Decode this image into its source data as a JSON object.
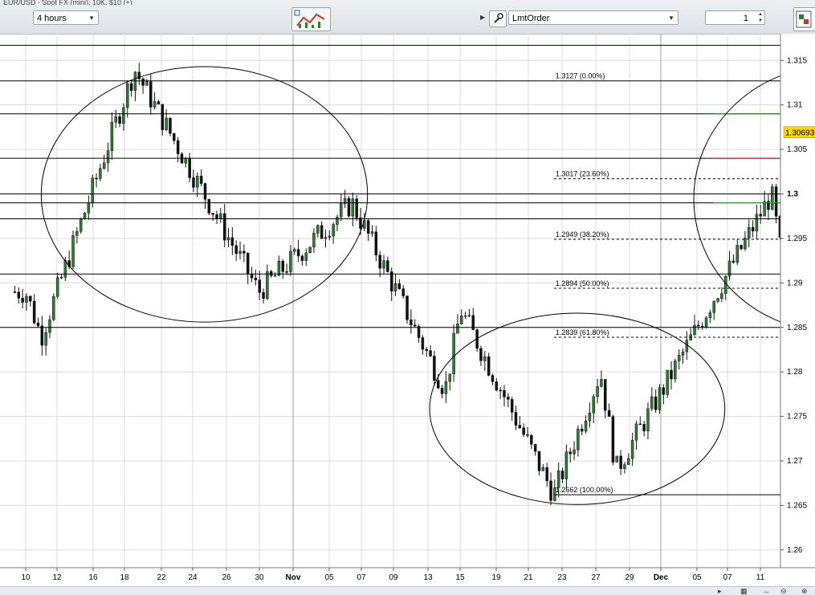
{
  "toolbar": {
    "title_text": "EUR/USD - Spot FX (mini): 10K, $10 (+)",
    "timeframe": "4 hours",
    "order_type": "LmtOrder",
    "quantity": "1"
  },
  "chart_data": {
    "type": "candlestick",
    "symbol": "EUR/USD",
    "interval": "4 hours",
    "ylim": [
      1.258,
      1.318
    ],
    "y_ticks": [
      "1.315",
      "1.31",
      "1.305",
      "1.3",
      "1.295",
      "1.29",
      "1.285",
      "1.28",
      "1.275",
      "1.27",
      "1.265",
      "1.26"
    ],
    "x_ticks": [
      "10",
      "12",
      "16",
      "18",
      "22",
      "24",
      "26",
      "30",
      "Nov",
      "05",
      "07",
      "09",
      "13",
      "15",
      "19",
      "21",
      "23",
      "27",
      "29",
      "Dec",
      "05",
      "07",
      "11"
    ],
    "current_price": "1.30693",
    "approx_swing_points": [
      {
        "date": "Oct 10",
        "price": 1.289
      },
      {
        "date": "Oct 11",
        "price": 1.284
      },
      {
        "date": "Oct 17",
        "price": 1.314
      },
      {
        "date": "Oct 25",
        "price": 1.289
      },
      {
        "date": "Oct 31",
        "price": 1.299
      },
      {
        "date": "Nov 06",
        "price": 1.278
      },
      {
        "date": "Nov 07",
        "price": 1.287
      },
      {
        "date": "Nov 13",
        "price": 1.2662
      },
      {
        "date": "Nov 16",
        "price": 1.28
      },
      {
        "date": "Nov 17",
        "price": 1.269
      },
      {
        "date": "Nov 20",
        "price": 1.278
      },
      {
        "date": "Nov 27",
        "price": 1.3
      },
      {
        "date": "Nov 28",
        "price": 1.289
      },
      {
        "date": "Dec 05",
        "price": 1.3127
      },
      {
        "date": "Dec 06",
        "price": 1.3069
      }
    ],
    "fibonacci_levels": [
      {
        "label": "1.3127 (0.00%)",
        "price": 1.3127
      },
      {
        "label": "1.3017 (23.60%)",
        "price": 1.3017
      },
      {
        "label": "1.2949 (38.20%)",
        "price": 1.2949
      },
      {
        "label": "1.2894 (50.00%)",
        "price": 1.2894
      },
      {
        "label": "1.2839 (61.80%)",
        "price": 1.2839
      },
      {
        "label": "1.2662 (100.00%)",
        "price": 1.2662
      }
    ],
    "horizontal_lines": [
      1.3167,
      1.3127,
      1.309,
      1.304,
      1.3,
      1.299,
      1.2972,
      1.291,
      1.285
    ],
    "order_lines": [
      {
        "price": 1.309,
        "color": "#2e8b2e"
      },
      {
        "price": 1.304,
        "color": "#a52a2a"
      },
      {
        "price": 1.299,
        "color": "#2e8b2e"
      }
    ],
    "annotations": [
      {
        "shape": "ellipse",
        "from_date": "Oct 11",
        "to_date": "Nov 01",
        "from_price": 1.3143,
        "to_price": 1.2856
      },
      {
        "shape": "ellipse",
        "from_date": "Nov 05",
        "to_date": "Nov 24",
        "from_price": 1.2866,
        "to_price": 1.2651
      },
      {
        "shape": "ellipse",
        "from_date": "Nov 22",
        "to_date": "Dec 10",
        "from_price": 1.3144,
        "to_price": 1.2845
      }
    ],
    "colors": {
      "up": "#2e7d32",
      "down": "#111111",
      "grid": "#dcdcdc",
      "price_tag": "#ffd800"
    }
  }
}
